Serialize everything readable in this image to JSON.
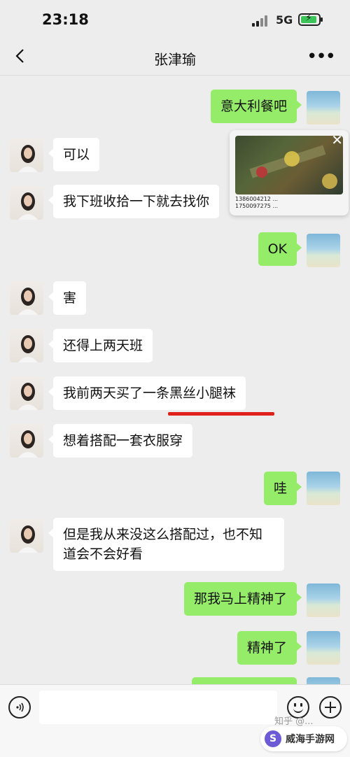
{
  "status_bar": {
    "time": "23:18",
    "network": "5G"
  },
  "header": {
    "title": "张津瑜",
    "more": "•••"
  },
  "messages": [
    {
      "side": "out",
      "text": "意大利餐吧"
    },
    {
      "side": "in",
      "text": "可以"
    },
    {
      "side": "in",
      "text": "我下班收拾一下就去找你"
    },
    {
      "side": "out",
      "text": "OK"
    },
    {
      "side": "in",
      "text": "害"
    },
    {
      "side": "in",
      "text": "还得上两天班"
    },
    {
      "side": "in",
      "text": "我前两天买了一条黑丝小腿袜"
    },
    {
      "side": "in",
      "text": "想着搭配一套衣服穿"
    },
    {
      "side": "out",
      "text": "哇"
    },
    {
      "side": "in",
      "text": "但是我从来没这么搭配过，也不知道会不会好看"
    },
    {
      "side": "out",
      "text": "那我马上精神了"
    },
    {
      "side": "out",
      "text": "精神了"
    }
  ],
  "floating_window": {
    "close": "✕",
    "info_line1": "1386004212 ...",
    "info_line2": "1750097275 ..."
  },
  "watermark": "知乎 @...",
  "site_badge": {
    "logo": "S",
    "name": "威海手游网"
  },
  "colors": {
    "outgoing_bubble": "#95ec69",
    "incoming_bubble": "#ffffff",
    "background": "#ededed",
    "underline": "#e0211b"
  },
  "icons": [
    "back-icon",
    "more-icon",
    "voice-icon",
    "emoji-icon",
    "plus-icon",
    "close-icon"
  ]
}
